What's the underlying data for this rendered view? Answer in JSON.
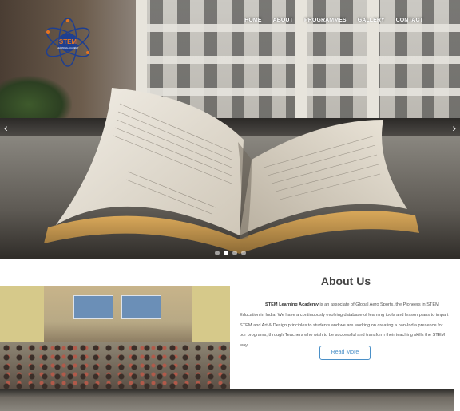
{
  "logo": {
    "text": "STEM",
    "subtext": "LEARNING ACADEMY"
  },
  "nav": {
    "items": [
      {
        "label": "HOME"
      },
      {
        "label": "ABOUT"
      },
      {
        "label": "PROGRAMMES"
      },
      {
        "label": "GALLERY"
      },
      {
        "label": "CONTACT"
      }
    ]
  },
  "slider": {
    "prev_label": "‹",
    "next_label": "›",
    "slide_count": 4,
    "active_slide": 2
  },
  "about": {
    "title": "About Us",
    "brand": "STEM Learning Academy",
    "body": " is an associate of Global Aero Sports, the Pioneers in STEM Education in India. We have a continuously evolving database of learning tools and lesson plans to impart STEM and Art & Design principles to students and we are working on creating a pan-India presence for our programs, through Teachers who wish to be successful and transform their teaching skills the STEM way.",
    "button_label": "Read More"
  },
  "colors": {
    "accent": "#4a90c8",
    "logo_orange": "#e8741e",
    "logo_blue": "#1f3f8f"
  }
}
